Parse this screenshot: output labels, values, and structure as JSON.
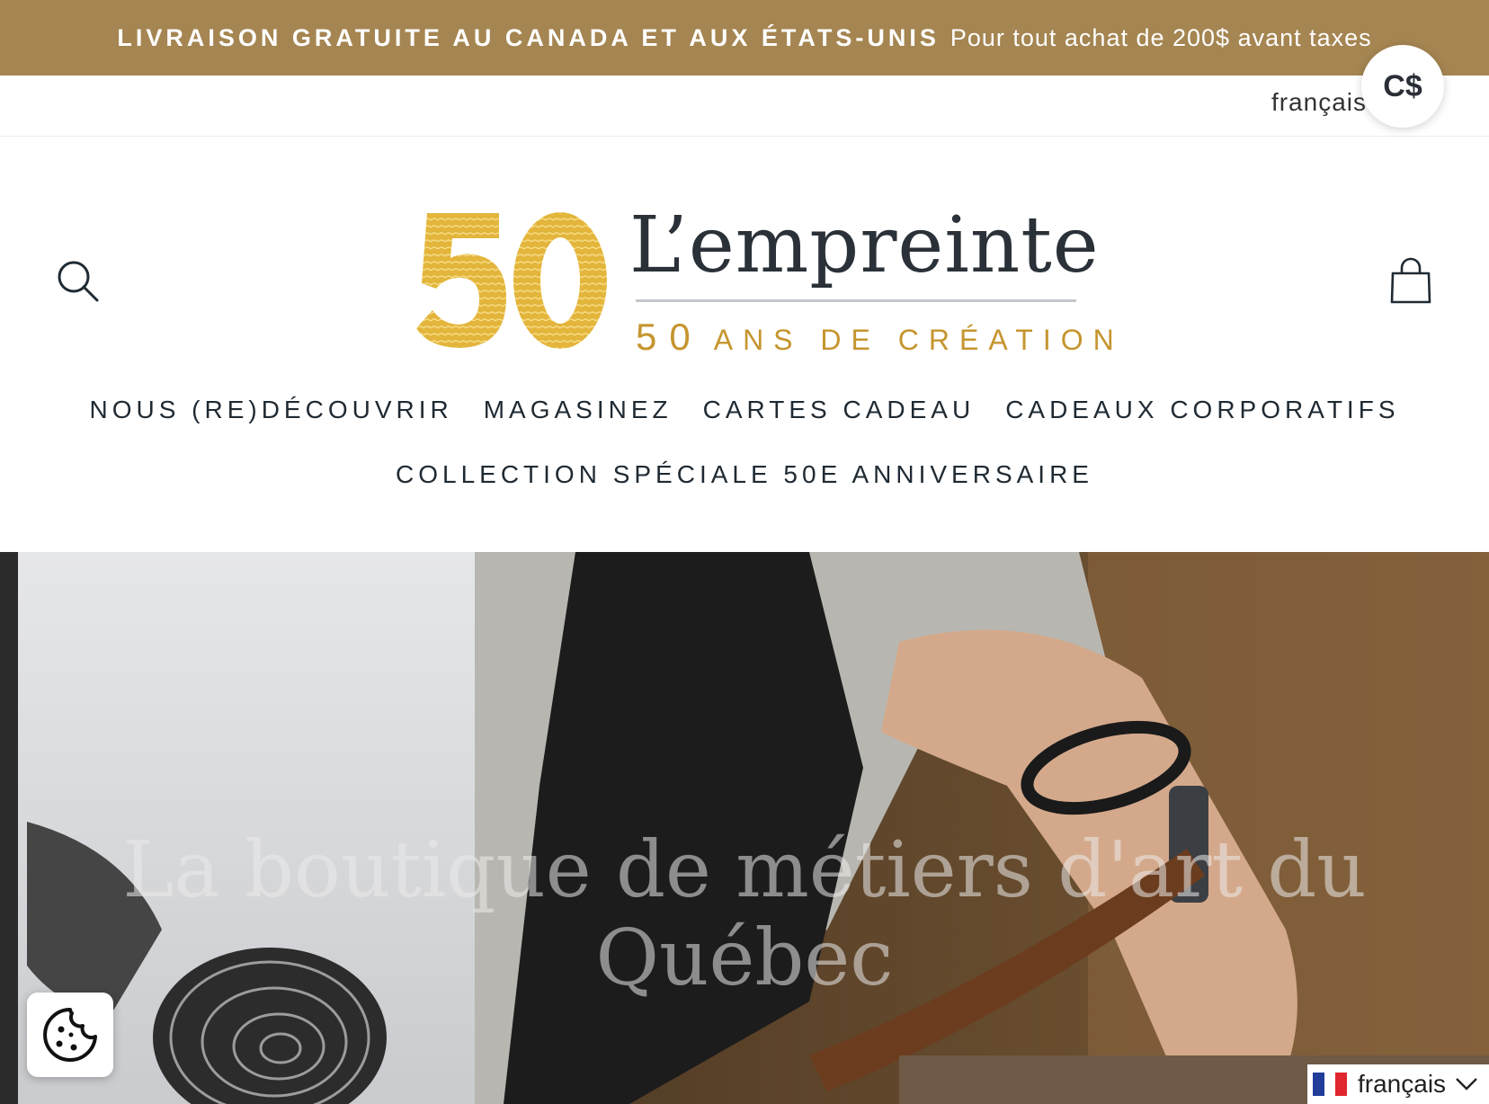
{
  "announcement": {
    "strong": "LIVRAISON GRATUITE AU CANADA ET AUX ÉTATS-UNIS",
    "light": "Pour tout achat de 200$ avant taxes"
  },
  "utility": {
    "language": "français",
    "currency": "C$"
  },
  "logo": {
    "number": "50",
    "wordmark": "L’empreinte",
    "sub_number": "50",
    "sub_text": "ANS DE CRÉATION"
  },
  "nav": {
    "row1": [
      "NOUS (RE)DÉCOUVRIR",
      "MAGASINEZ",
      "CARTES CADEAU",
      "CADEAUX CORPORATIFS"
    ],
    "row2": [
      "COLLECTION SPÉCIALE 50E ANNIVERSAIRE"
    ]
  },
  "hero": {
    "title": "La boutique de métiers d'art du Québec"
  },
  "language_switcher": {
    "label": "français"
  },
  "colors": {
    "announcement_bg": "#a58551",
    "logo_gold": "#c6952f",
    "text_dark": "#1f2a33"
  },
  "icons": [
    "search-icon",
    "cart-icon",
    "cookie-icon",
    "french-flag-icon",
    "chevron-down-icon"
  ]
}
